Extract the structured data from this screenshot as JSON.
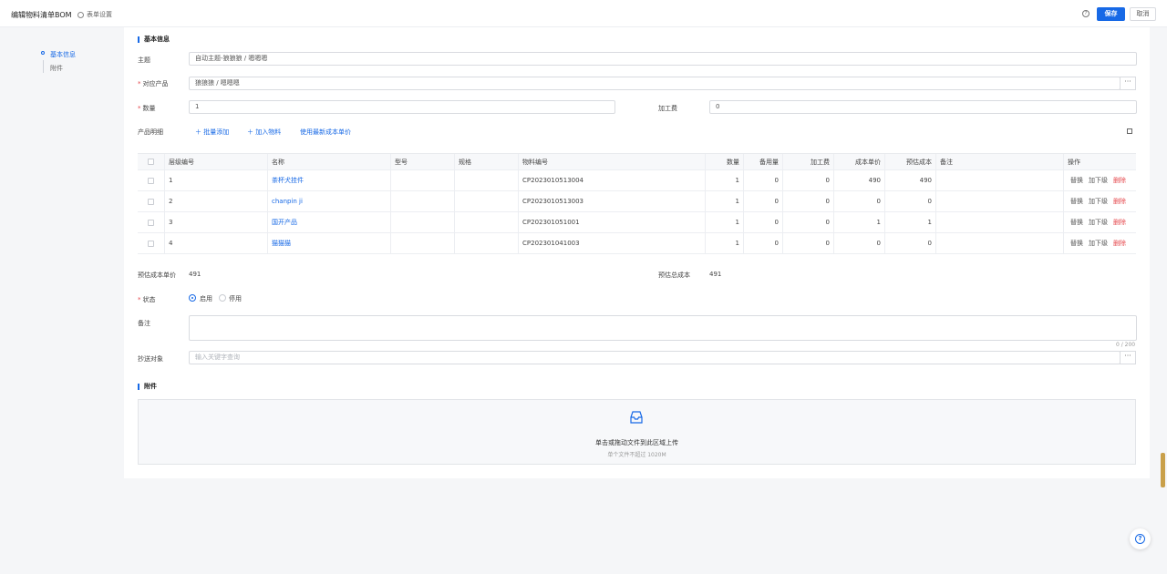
{
  "header": {
    "title": "编辑物料清单BOM",
    "form_settings": "表单设置",
    "save": "保存",
    "cancel": "取消",
    "help_icon": "?"
  },
  "sidenav": {
    "items": [
      {
        "label": "基本信息"
      },
      {
        "label": "附件"
      }
    ]
  },
  "basic": {
    "section_title": "基本信息",
    "subject_label": "主题",
    "subject_value": "自动主题-狼狼狼 / 嗯嗯嗯",
    "product_label": "对应产品",
    "product_value": "狼狼狼 / 嗯嗯嗯",
    "quantity_label": "数量",
    "quantity_value": "1",
    "processing_fee_label": "加工费",
    "processing_fee_value": "0",
    "detail_label": "产品明细",
    "batch_add": "批量添加",
    "add_material": "加入物料",
    "use_latest_cost": "使用最新成本单价",
    "more": "···"
  },
  "table": {
    "headers": [
      "层级编号",
      "名称",
      "型号",
      "规格",
      "物料编号",
      "数量",
      "备用量",
      "加工费",
      "成本单价",
      "预估成本",
      "备注",
      "操作"
    ],
    "rows": [
      {
        "level": "1",
        "name": "茶杯犬挂件",
        "model": "",
        "spec": "",
        "code": "CP2023010513004",
        "qty": "1",
        "spare": "0",
        "fee": "0",
        "unit_cost": "490",
        "est_cost": "490",
        "note": ""
      },
      {
        "level": "2",
        "name": "chanpin ji",
        "model": "",
        "spec": "",
        "code": "CP2023010513003",
        "qty": "1",
        "spare": "0",
        "fee": "0",
        "unit_cost": "0",
        "est_cost": "0",
        "note": ""
      },
      {
        "level": "3",
        "name": "国开产品",
        "model": "",
        "spec": "",
        "code": "CP2023010510​01",
        "qty": "1",
        "spare": "0",
        "fee": "0",
        "unit_cost": "1",
        "est_cost": "1",
        "note": ""
      },
      {
        "level": "4",
        "name": "猫猫猫",
        "model": "",
        "spec": "",
        "code": "CP2023010410​03",
        "qty": "1",
        "spare": "0",
        "fee": "0",
        "unit_cost": "0",
        "est_cost": "0",
        "note": ""
      }
    ],
    "ops": {
      "replace": "替换",
      "add_sub": "加下级",
      "delete": "删除"
    }
  },
  "summary": {
    "est_unit_cost_label": "预估成本单价",
    "est_unit_cost_value": "491",
    "est_total_cost_label": "预估总成本",
    "est_total_cost_value": "491"
  },
  "status": {
    "label": "状态",
    "options": [
      "启用",
      "停用"
    ],
    "selected": "启用"
  },
  "remark": {
    "label": "备注",
    "counter": "0 / 200"
  },
  "cc": {
    "label": "抄送对象",
    "placeholder": "输入关键字查询"
  },
  "attachment": {
    "section_title": "附件",
    "upload_text": "单击或拖动文件到此区域上传",
    "upload_hint": "单个文件不超过 1020M"
  },
  "colors": {
    "accent": "#1769e6",
    "danger": "#e5484d"
  }
}
